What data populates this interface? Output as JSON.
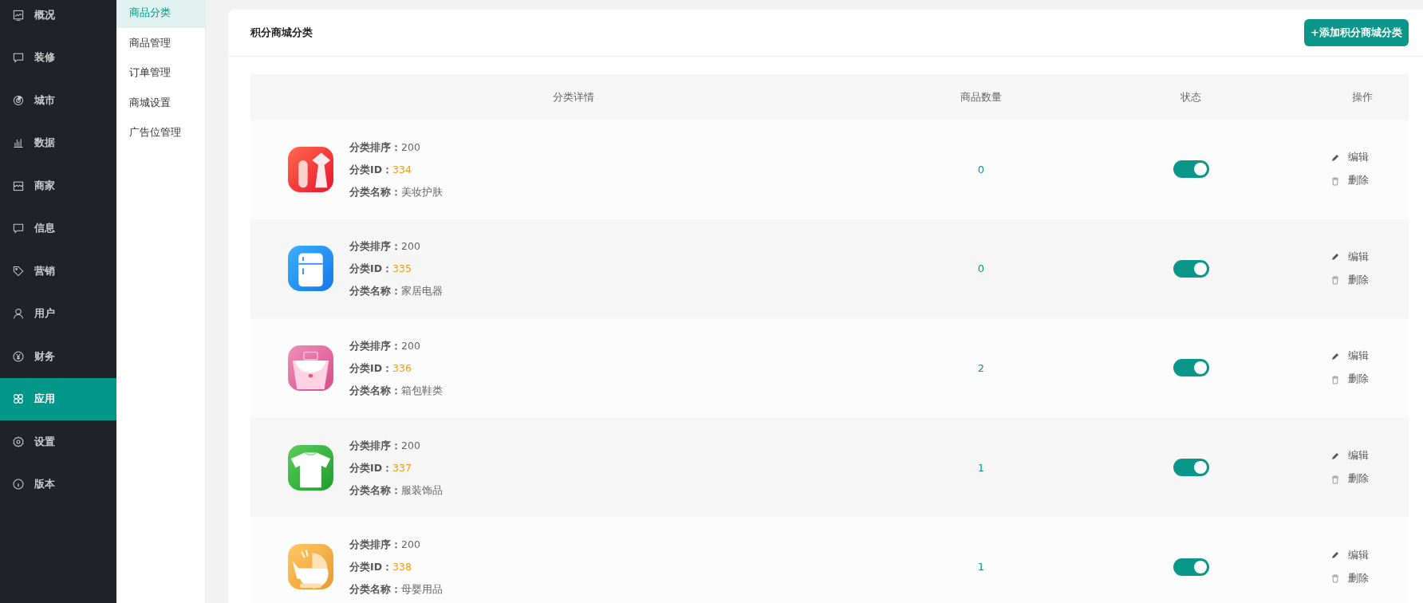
{
  "sidebar": {
    "items": [
      {
        "label": "概况",
        "selected": false
      },
      {
        "label": "装修",
        "selected": false
      },
      {
        "label": "城市",
        "selected": false
      },
      {
        "label": "数据",
        "selected": false
      },
      {
        "label": "商家",
        "selected": false
      },
      {
        "label": "信息",
        "selected": false
      },
      {
        "label": "营销",
        "selected": false
      },
      {
        "label": "用户",
        "selected": false
      },
      {
        "label": "财务",
        "selected": false
      },
      {
        "label": "应用",
        "selected": true
      },
      {
        "label": "设置",
        "selected": false
      },
      {
        "label": "版本",
        "selected": false
      }
    ]
  },
  "submenu": {
    "items": [
      {
        "label": "商品分类",
        "selected": true
      },
      {
        "label": "商品管理",
        "selected": false
      },
      {
        "label": "订单管理",
        "selected": false
      },
      {
        "label": "商城设置",
        "selected": false
      },
      {
        "label": "广告位管理",
        "selected": false
      }
    ]
  },
  "card": {
    "title": "积分商城分类",
    "add_button": "+添加积分商城分类"
  },
  "table": {
    "columns": [
      "分类详情",
      "商品数量",
      "状态",
      "操作"
    ],
    "rows": [
      {
        "kind": "cosmetics",
        "sort_label": "分类排序：",
        "sort": "200",
        "id_label": "分类ID：",
        "id": "334",
        "name_label": "分类名称：",
        "name": "美妆护肤",
        "count": "0",
        "enabled": true,
        "edit": "编辑",
        "delete": "删除"
      },
      {
        "kind": "appliance",
        "sort_label": "分类排序：",
        "sort": "200",
        "id_label": "分类ID：",
        "id": "335",
        "name_label": "分类名称：",
        "name": "家居电器",
        "count": "0",
        "enabled": true,
        "edit": "编辑",
        "delete": "删除"
      },
      {
        "kind": "bag",
        "sort_label": "分类排序：",
        "sort": "200",
        "id_label": "分类ID：",
        "id": "336",
        "name_label": "分类名称：",
        "name": "箱包鞋类",
        "count": "2",
        "enabled": true,
        "edit": "编辑",
        "delete": "删除"
      },
      {
        "kind": "clothing",
        "sort_label": "分类排序：",
        "sort": "200",
        "id_label": "分类ID：",
        "id": "337",
        "name_label": "分类名称：",
        "name": "服装饰品",
        "count": "1",
        "enabled": true,
        "edit": "编辑",
        "delete": "删除"
      },
      {
        "kind": "baby",
        "sort_label": "分类排序：",
        "sort": "200",
        "id_label": "分类ID：",
        "id": "338",
        "name_label": "分类名称：",
        "name": "母婴用品",
        "count": "1",
        "enabled": true,
        "edit": "编辑",
        "delete": "删除"
      }
    ]
  }
}
